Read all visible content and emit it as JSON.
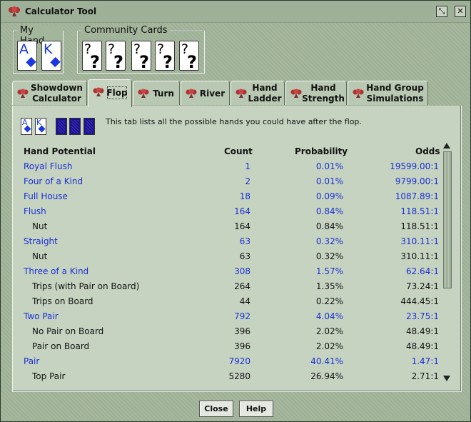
{
  "window": {
    "title": "Calculator Tool",
    "minimize_glyph": "⤡",
    "close_glyph": "✕"
  },
  "my_hand": {
    "label": "My Hand",
    "cards": [
      {
        "rank": "A",
        "suit": "diamonds"
      },
      {
        "rank": "K",
        "suit": "diamonds"
      }
    ]
  },
  "community": {
    "label": "Community Cards",
    "cards": [
      "?",
      "?",
      "?",
      "?",
      "?"
    ]
  },
  "tabs": [
    {
      "label": "Showdown Calculator",
      "active": false
    },
    {
      "label": "Flop",
      "active": true
    },
    {
      "label": "Turn",
      "active": false
    },
    {
      "label": "River",
      "active": false
    },
    {
      "label": "Hand Ladder",
      "active": false
    },
    {
      "label": "Hand Strength",
      "active": false
    },
    {
      "label": "Hand Group Simulations",
      "active": false
    }
  ],
  "panel": {
    "mini_cards": [
      {
        "rank": "A",
        "suit": "diamonds"
      },
      {
        "rank": "K",
        "suit": "diamonds"
      }
    ],
    "hint": "This tab lists all the possible hands you could have after the flop."
  },
  "table": {
    "headers": {
      "hand": "Hand Potential",
      "count": "Count",
      "probability": "Probability",
      "odds": "Odds"
    },
    "rows": [
      {
        "hand": "Royal Flush",
        "count": "1",
        "probability": "0.01%",
        "odds": "19599.00:1",
        "sub": false,
        "color": "blue"
      },
      {
        "hand": "Four of a Kind",
        "count": "2",
        "probability": "0.01%",
        "odds": "9799.00:1",
        "sub": false,
        "color": "blue"
      },
      {
        "hand": "Full House",
        "count": "18",
        "probability": "0.09%",
        "odds": "1087.89:1",
        "sub": false,
        "color": "blue"
      },
      {
        "hand": "Flush",
        "count": "164",
        "probability": "0.84%",
        "odds": "118.51:1",
        "sub": false,
        "color": "blue"
      },
      {
        "hand": "Nut",
        "count": "164",
        "probability": "0.84%",
        "odds": "118.51:1",
        "sub": true,
        "color": "black"
      },
      {
        "hand": "Straight",
        "count": "63",
        "probability": "0.32%",
        "odds": "310.11:1",
        "sub": false,
        "color": "blue"
      },
      {
        "hand": "Nut",
        "count": "63",
        "probability": "0.32%",
        "odds": "310.11:1",
        "sub": true,
        "color": "black"
      },
      {
        "hand": "Three of a Kind",
        "count": "308",
        "probability": "1.57%",
        "odds": "62.64:1",
        "sub": false,
        "color": "blue"
      },
      {
        "hand": "Trips (with Pair on Board)",
        "count": "264",
        "probability": "1.35%",
        "odds": "73.24:1",
        "sub": true,
        "color": "black"
      },
      {
        "hand": "Trips on Board",
        "count": "44",
        "probability": "0.22%",
        "odds": "444.45:1",
        "sub": true,
        "color": "black"
      },
      {
        "hand": "Two Pair",
        "count": "792",
        "probability": "4.04%",
        "odds": "23.75:1",
        "sub": false,
        "color": "blue"
      },
      {
        "hand": "No Pair on Board",
        "count": "396",
        "probability": "2.02%",
        "odds": "48.49:1",
        "sub": true,
        "color": "black"
      },
      {
        "hand": "Pair on Board",
        "count": "396",
        "probability": "2.02%",
        "odds": "48.49:1",
        "sub": true,
        "color": "black"
      },
      {
        "hand": "Pair",
        "count": "7920",
        "probability": "40.41%",
        "odds": "1.47:1",
        "sub": false,
        "color": "blue"
      },
      {
        "hand": "Top Pair",
        "count": "5280",
        "probability": "26.94%",
        "odds": "2.71:1",
        "sub": true,
        "color": "black"
      }
    ]
  },
  "buttons": {
    "close": "Close",
    "help": "Help"
  },
  "colors": {
    "background": "#a3b59b",
    "link_blue": "#1a2fd6",
    "card_blue": "#1a37e0"
  }
}
